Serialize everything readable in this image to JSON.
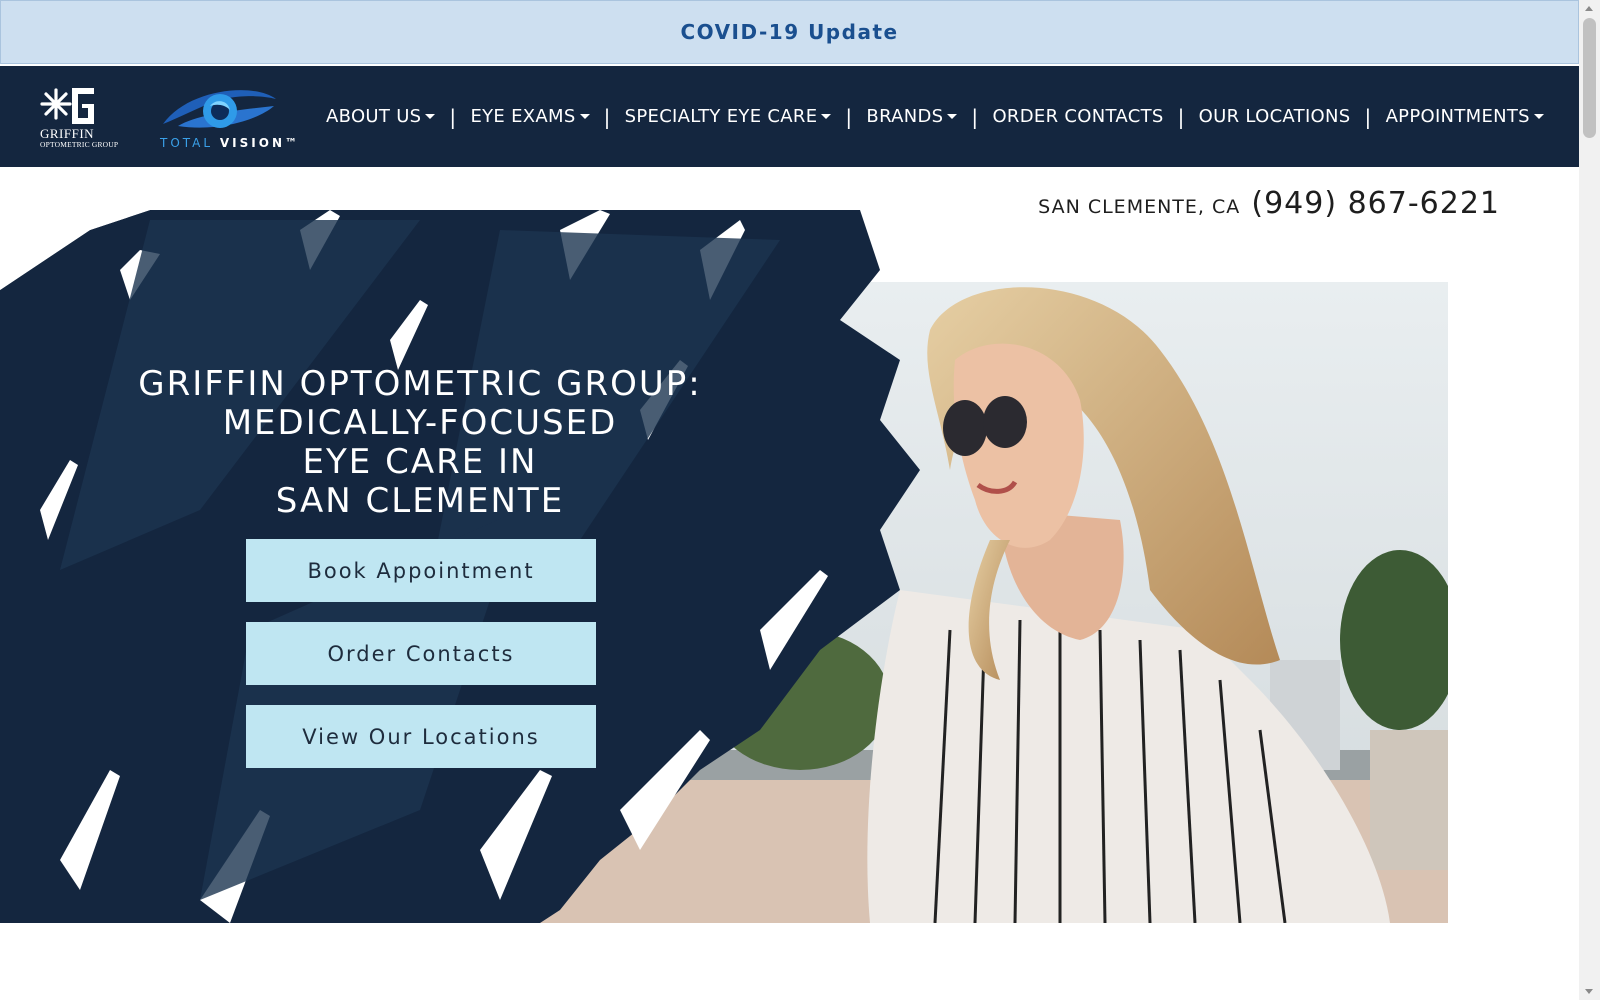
{
  "covid_banner": {
    "label": "COVID-19 Update"
  },
  "logos": {
    "griffin_name": "GRIFFIN",
    "griffin_sub": "OPTOMETRIC GROUP",
    "total_vision_1": "TOTAL ",
    "total_vision_2": "VISION™"
  },
  "nav": {
    "items": [
      {
        "label": "ABOUT US",
        "dropdown": true
      },
      {
        "label": "EYE EXAMS",
        "dropdown": true
      },
      {
        "label": "SPECIALTY EYE CARE",
        "dropdown": true
      },
      {
        "label": "BRANDS",
        "dropdown": true
      },
      {
        "label": "ORDER CONTACTS",
        "dropdown": false
      },
      {
        "label": "OUR LOCATIONS",
        "dropdown": false
      },
      {
        "label": "APPOINTMENTS",
        "dropdown": true
      }
    ],
    "separator": "|"
  },
  "contact": {
    "location": "SAN CLEMENTE, CA",
    "phone": "(949) 867-6221"
  },
  "hero": {
    "title_lines": [
      "GRIFFIN OPTOMETRIC GROUP:",
      "MEDICALLY-FOCUSED",
      "EYE CARE IN",
      "SAN CLEMENTE"
    ],
    "buttons": [
      "Book Appointment",
      "Order Contacts",
      "View Our Locations"
    ]
  },
  "colors": {
    "covid_bg": "#cddff0",
    "covid_text": "#1a4f8f",
    "navbar_bg": "#14263f",
    "brush": "#14263f",
    "button_bg": "#bfe6f2"
  },
  "icons": {
    "caret": "chevron-down-icon",
    "scroll_up": "scroll-up-arrow",
    "scroll_down": "scroll-down-arrow"
  }
}
